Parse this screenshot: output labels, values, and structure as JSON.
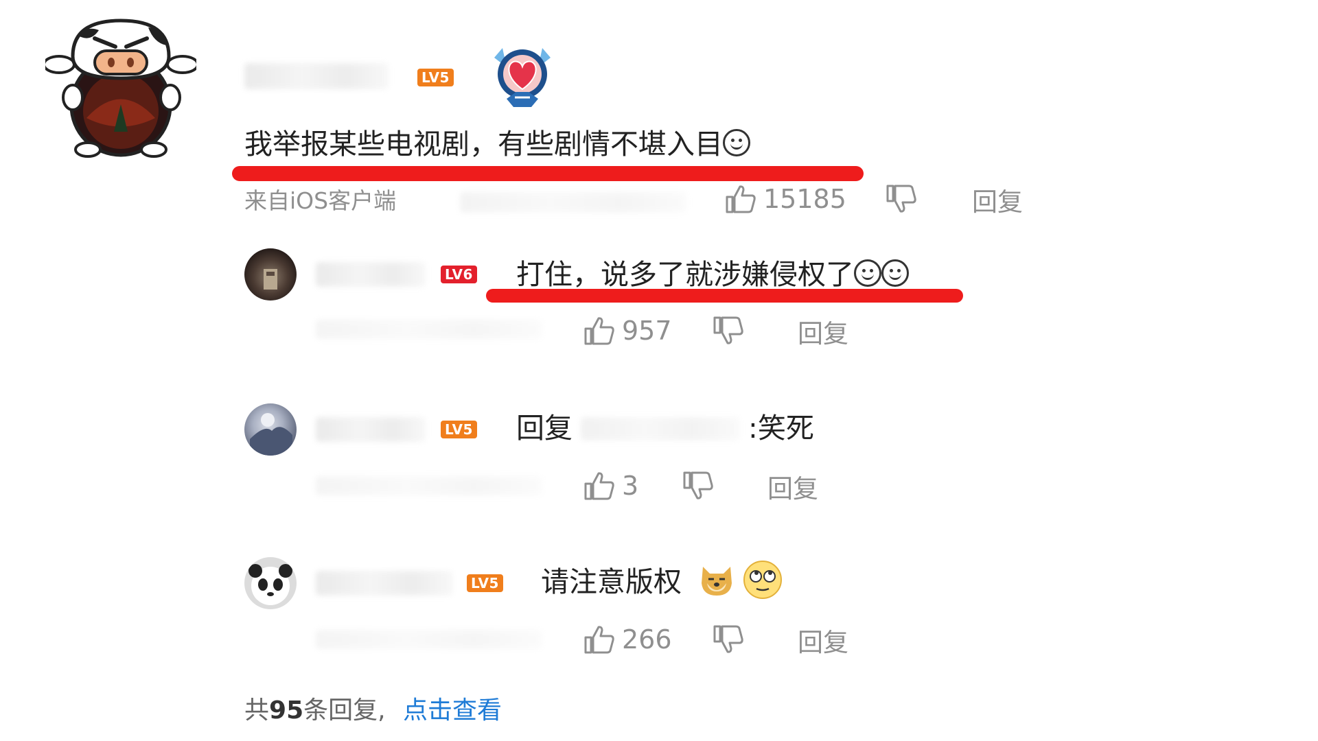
{
  "main_comment": {
    "level": "LV5",
    "text": "我举报某些电视剧，有些剧情不堪入目",
    "source": "来自iOS客户端",
    "likes": "15185",
    "reply_label": "回复",
    "badge_icon": "heart-medal-icon"
  },
  "replies": [
    {
      "level": "LV6",
      "text": "打住，说多了就涉嫌侵权了",
      "likes": "957",
      "reply_label": "回复"
    },
    {
      "level": "LV5",
      "prefix": "回复",
      "suffix": ":笑死",
      "likes": "3",
      "reply_label": "回复"
    },
    {
      "level": "LV5",
      "text": "请注意版权",
      "likes": "266",
      "reply_label": "回复"
    }
  ],
  "footer": {
    "prefix": "共",
    "count": "95",
    "suffix": "条回复,",
    "link": "点击查看"
  },
  "colors": {
    "underline": "#ee1c1c",
    "lv_orange": "#f07e1c",
    "lv_red": "#e3202c",
    "link": "#1e7bd6",
    "meta": "#8f8f8f"
  }
}
